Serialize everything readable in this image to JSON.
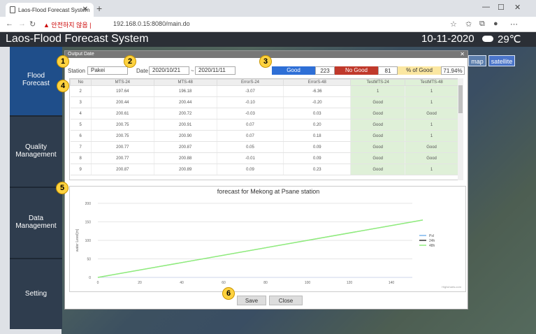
{
  "browser": {
    "tab_title": "Laos-Flood Forecast System",
    "security_warning": "안전하지 않음",
    "url": "192.168.0.15:8080/main.do"
  },
  "app": {
    "title": "Laos-Flood Forecast System",
    "date": "10-11-2020",
    "temperature": "29℃"
  },
  "map_buttons": {
    "map": "map",
    "satellite": "satellite"
  },
  "sidebar": [
    {
      "line1": "Flood",
      "line2": "Forecast"
    },
    {
      "line1": "Quality",
      "line2": "Management"
    },
    {
      "line1": "Data",
      "line2": "Management"
    },
    {
      "line1": "Setting",
      "line2": ""
    }
  ],
  "dialog": {
    "title": "Output Date",
    "station_label": "Station",
    "station_value": "Pakei",
    "date_label": "Date",
    "date_from": "2020/10/21",
    "date_sep": "~",
    "date_to": "2020/11/11",
    "good_label": "Good",
    "good_count": "223",
    "nogood_label": "No Good",
    "nogood_count": "81",
    "pct_label": "% of Good",
    "pct_value": "71.94%",
    "save": "Save",
    "close": "Close"
  },
  "table": {
    "headers": [
      "No",
      "MTS-24",
      "MTS-48",
      "ErrorS-24",
      "ErrorS-48",
      "TestMTS-24",
      "TestMTS-48"
    ],
    "rows": [
      [
        "2",
        "197.64",
        "196.18",
        "-3.07",
        "-6.36",
        "1",
        "1"
      ],
      [
        "3",
        "200.44",
        "200.44",
        "-0.10",
        "-0.20",
        "Good",
        "1"
      ],
      [
        "4",
        "200.61",
        "200.72",
        "-0.03",
        "0.03",
        "Good",
        "Good"
      ],
      [
        "5",
        "200.75",
        "200.91",
        "0.07",
        "0.20",
        "Good",
        "1"
      ],
      [
        "6",
        "200.75",
        "200.90",
        "0.07",
        "0.18",
        "Good",
        "1"
      ],
      [
        "7",
        "200.77",
        "200.87",
        "0.05",
        "0.09",
        "Good",
        "Good"
      ],
      [
        "8",
        "200.77",
        "200.88",
        "-0.01",
        "0.09",
        "Good",
        "Good"
      ],
      [
        "9",
        "200.87",
        "200.89",
        "0.09",
        "0.23",
        "Good",
        "1"
      ]
    ]
  },
  "chart_data": {
    "type": "line",
    "title": "forecast for Mekong at Psane station",
    "ylabel": "water Level[m]",
    "xlim": [
      0,
      150
    ],
    "ylim": [
      0,
      200
    ],
    "xticks": [
      0,
      20,
      40,
      60,
      80,
      100,
      120,
      140
    ],
    "yticks": [
      0,
      50,
      100,
      150,
      200
    ],
    "grid": true,
    "legend_position": "right",
    "credit": "Highcharts.com",
    "series": [
      {
        "name": "Psl",
        "color": "#7cb5ec",
        "x": [
          0,
          155
        ],
        "values": [
          0,
          155
        ]
      },
      {
        "name": "24h",
        "color": "#333333",
        "x": [
          0,
          155
        ],
        "values": [
          0,
          155
        ]
      },
      {
        "name": "48h",
        "color": "#90ed7d",
        "x": [
          0,
          155
        ],
        "values": [
          0,
          155
        ]
      }
    ]
  },
  "badges": [
    "1",
    "2",
    "3",
    "4",
    "5",
    "6"
  ],
  "colors": {
    "good": "#2e6fd6",
    "nogood": "#c0392b",
    "pct": "#fbe7a1",
    "test_cell": "#dff0d8",
    "sidebar": "#2f3d4e"
  }
}
